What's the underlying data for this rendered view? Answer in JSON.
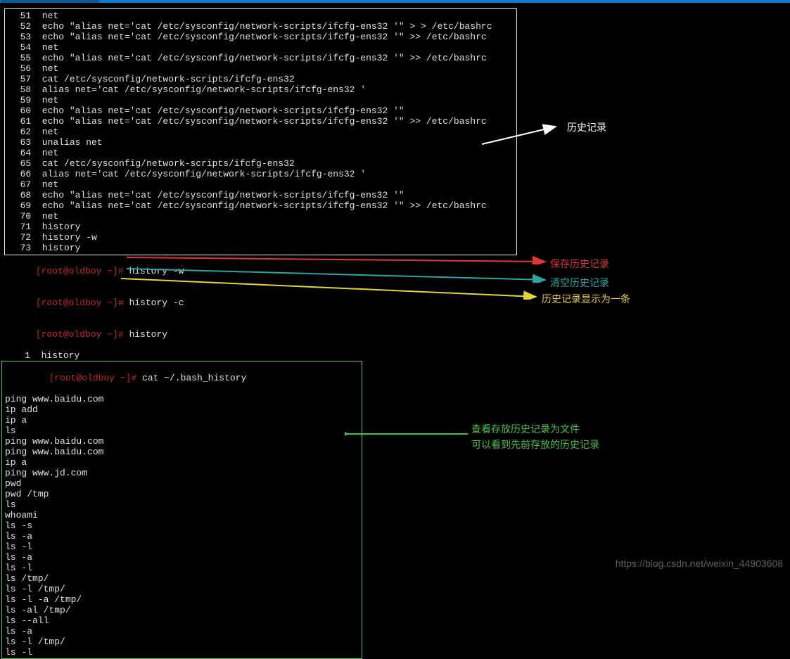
{
  "history_lines": [
    {
      "n": "51",
      "t": "net"
    },
    {
      "n": "52",
      "t": "echo \"alias net='cat /etc/sysconfig/network-scripts/ifcfg-ens32 '\" > > /etc/bashrc"
    },
    {
      "n": "53",
      "t": "echo \"alias net='cat /etc/sysconfig/network-scripts/ifcfg-ens32 '\" >> /etc/bashrc"
    },
    {
      "n": "54",
      "t": "net"
    },
    {
      "n": "55",
      "t": "echo \"alias net='cat /etc/sysconfig/network-scripts/ifcfg-ens32 '\" >> /etc/bashrc"
    },
    {
      "n": "56",
      "t": "net"
    },
    {
      "n": "57",
      "t": "cat /etc/sysconfig/network-scripts/ifcfg-ens32"
    },
    {
      "n": "58",
      "t": "alias net='cat /etc/sysconfig/network-scripts/ifcfg-ens32 '"
    },
    {
      "n": "59",
      "t": "net"
    },
    {
      "n": "60",
      "t": "echo \"alias net='cat /etc/sysconfig/network-scripts/ifcfg-ens32 '\""
    },
    {
      "n": "61",
      "t": "echo \"alias net='cat /etc/sysconfig/network-scripts/ifcfg-ens32 '\" >> /etc/bashrc"
    },
    {
      "n": "62",
      "t": "net"
    },
    {
      "n": "63",
      "t": "unalias net"
    },
    {
      "n": "64",
      "t": "net"
    },
    {
      "n": "65",
      "t": "cat /etc/sysconfig/network-scripts/ifcfg-ens32"
    },
    {
      "n": "66",
      "t": "alias net='cat /etc/sysconfig/network-scripts/ifcfg-ens32 '"
    },
    {
      "n": "67",
      "t": "net"
    },
    {
      "n": "68",
      "t": "echo \"alias net='cat /etc/sysconfig/network-scripts/ifcfg-ens32 '\""
    },
    {
      "n": "69",
      "t": "echo \"alias net='cat /etc/sysconfig/network-scripts/ifcfg-ens32 '\" >> /etc/bashrc"
    },
    {
      "n": "70",
      "t": "net"
    },
    {
      "n": "71",
      "t": "history"
    },
    {
      "n": "72",
      "t": "history -w"
    },
    {
      "n": "73",
      "t": "history"
    }
  ],
  "prompt1": {
    "pre": "[root@oldboy ~]# ",
    "cmd": "history -w"
  },
  "prompt2": {
    "pre": "[root@oldboy ~]# ",
    "cmd": "history -c"
  },
  "prompt3": {
    "pre": "[root@oldboy ~]# ",
    "cmd": "history"
  },
  "history_one": {
    "n": "1",
    "t": "history"
  },
  "prompt4": {
    "pre": "[root@oldboy ~]# ",
    "cmd": "cat ~/.bash_history"
  },
  "bash_history_lines": [
    "ping www.baidu.com",
    "ip add",
    "ip a",
    "ls",
    "ping www.baidu.com",
    "ping www.baidu.com",
    "ip a",
    "ping www.jd.com",
    "pwd",
    "pwd /tmp",
    "ls",
    "whoami",
    "ls -s",
    "ls -a",
    "ls -l",
    "ls -a",
    "ls -l",
    "ls /tmp/",
    "ls -l /tmp/",
    "ls -l -a /tmp/",
    "ls -al /tmp/",
    "ls --all",
    "ls -a",
    "ls -l /tmp/",
    "ls -l"
  ],
  "annotations": {
    "history": "历史记录",
    "save": "保存历史记录",
    "clear": "清空历史记录",
    "one": "历史记录显示为一条",
    "file1": "查看存放历史记录为文件",
    "file2": "可以看到先前存放的历史记录"
  },
  "watermark": "https://blog.csdn.net/weixin_44903608"
}
